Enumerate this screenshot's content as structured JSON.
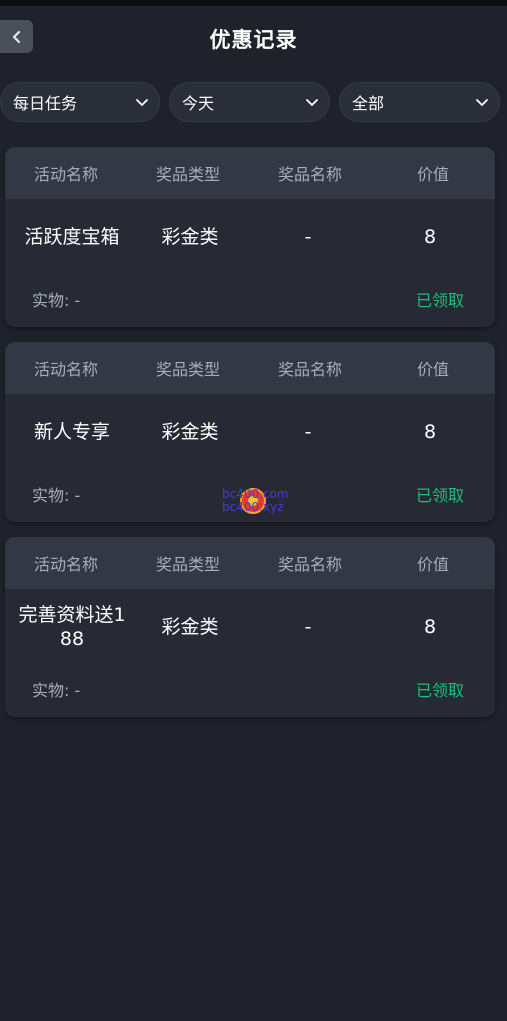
{
  "header": {
    "title": "优惠记录",
    "back_icon": "chevron-left-icon"
  },
  "filters": [
    {
      "label": "每日任务",
      "icon": "chevron-down-icon"
    },
    {
      "label": "今天",
      "icon": "chevron-down-icon"
    },
    {
      "label": "全部",
      "icon": "chevron-down-icon"
    }
  ],
  "columns": [
    "活动名称",
    "奖品类型",
    "奖品名称",
    "价值"
  ],
  "records": [
    {
      "activity": "活跃度宝箱",
      "prize_type": "彩金类",
      "prize_name": "-",
      "value": "8",
      "physical": "实物: -",
      "status": "已领取"
    },
    {
      "activity": "新人专享",
      "prize_type": "彩金类",
      "prize_name": "-",
      "value": "8",
      "physical": "实物: -",
      "status": "已领取"
    },
    {
      "activity": "完善资料送1\n88",
      "prize_type": "彩金类",
      "prize_name": "-",
      "value": "8",
      "physical": "实物: -",
      "status": "已领取"
    }
  ],
  "watermark": {
    "line1": "bc400.com",
    "line2": "bc400.xyz"
  },
  "colors": {
    "background": "#1f222b",
    "card": "#272a34",
    "card_header": "#333845",
    "status_green": "#1fbf7a"
  }
}
